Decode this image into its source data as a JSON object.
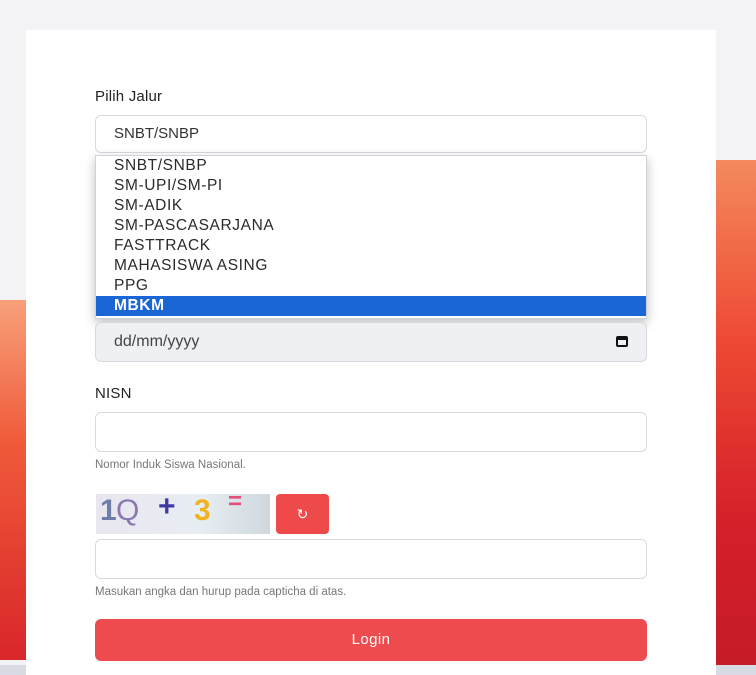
{
  "form": {
    "jalur_label": "Pilih Jalur",
    "jalur_selected": "SNBT/SNBP",
    "jalur_options": [
      "SNBT/SNBP",
      "SM-UPI/SM-PI",
      "SM-ADIK",
      "SM-PASCASARJANA",
      "FASTTRACK",
      "MAHASISWA ASING",
      "PPG",
      "MBKM"
    ],
    "jalur_highlighted": "MBKM",
    "date_placeholder": "dd/mm/yyyy",
    "nisn_label": "NISN",
    "nisn_value": "",
    "nisn_help": "Nomor Induk Siswa Nasional.",
    "captcha_text": [
      "1",
      "Q",
      "+",
      "3",
      "="
    ],
    "captcha_refresh_icon": "↻",
    "captcha_value": "",
    "captcha_help": "Masukan angka dan hurup pada capticha di atas.",
    "login_label": "Login"
  },
  "colors": {
    "accent": "#ee4b4e",
    "highlight": "#1a66d6",
    "bg_gradient_start": "#f48a5e",
    "bg_gradient_end": "#c51b26"
  },
  "icons": {
    "calendar": "calendar-icon",
    "refresh": "refresh-icon"
  }
}
